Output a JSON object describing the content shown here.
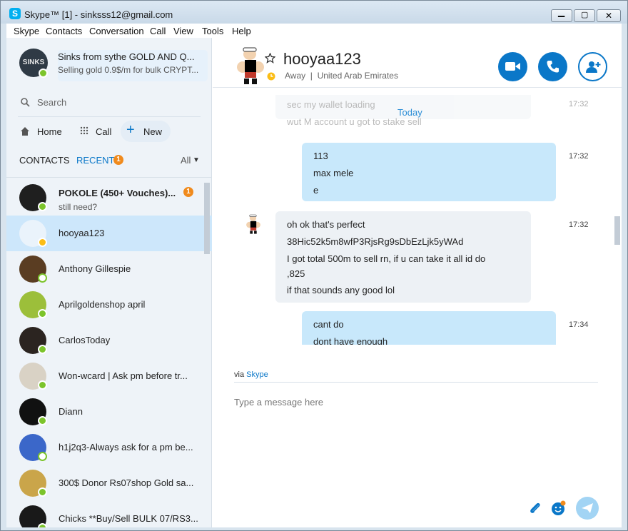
{
  "window": {
    "title": "Skype™ [1] - sinksss12@gmail.com",
    "minimize_label": "▁",
    "maximize_label": "▢",
    "close_label": "✕"
  },
  "menu": [
    "Skype",
    "Contacts",
    "Conversation",
    "Call",
    "View",
    "Tools",
    "Help"
  ],
  "profile": {
    "avatar_text": "SINKS",
    "name": "Sinks from sythe GOLD AND Q...",
    "mood": "Selling gold 0.9$/m for bulk CRYPT..."
  },
  "search": {
    "label": "Search"
  },
  "nav": {
    "home": "Home",
    "call": "Call",
    "new": "New"
  },
  "tabs": {
    "contacts": "CONTACTS",
    "recent": "RECENT",
    "recent_badge": "1",
    "filter": "All"
  },
  "contacts": [
    {
      "name": "POKOLE (450+ Vouches)...",
      "sub": "still need?",
      "status": "online",
      "badge": "1",
      "bold": true
    },
    {
      "name": "hooyaa123",
      "sub": "",
      "status": "away",
      "badge": "",
      "bold": false
    },
    {
      "name": "Anthony Gillespie",
      "sub": "",
      "status": "offline",
      "badge": "",
      "bold": false
    },
    {
      "name": "Aprilgoldenshop april",
      "sub": "",
      "status": "online",
      "badge": "",
      "bold": false
    },
    {
      "name": "CarlosToday",
      "sub": "",
      "status": "online",
      "badge": "",
      "bold": false
    },
    {
      "name": "Won-wcard | Ask pm before tr...",
      "sub": "",
      "status": "online",
      "badge": "",
      "bold": false
    },
    {
      "name": "Diann",
      "sub": "",
      "status": "online",
      "badge": "",
      "bold": false
    },
    {
      "name": "h1j2q3-Always ask for a pm be...",
      "sub": "",
      "status": "offline",
      "badge": "",
      "bold": false
    },
    {
      "name": "300$ Donor Rs07shop Gold sa...",
      "sub": "",
      "status": "online",
      "badge": "",
      "bold": false
    },
    {
      "name": "Chicks **Buy/Sell BULK 07/RS3...",
      "sub": "",
      "status": "online",
      "badge": "",
      "bold": false
    }
  ],
  "header": {
    "name": "hooyaa123",
    "status": "Away",
    "location": "United Arab Emirates"
  },
  "chat": {
    "today": "Today",
    "faded_lines": [
      "sec my wallet loading",
      "wut M account u got to stake sell"
    ],
    "faded_time": "17:32",
    "messages": [
      {
        "direction": "out",
        "time": "17:32",
        "lines": [
          "113",
          "max mele",
          "e"
        ]
      },
      {
        "direction": "in",
        "time": "17:32",
        "lines": [
          "oh ok that's perfect",
          "38Hic52k5m8wfP3RjsRg9sDbEzLjk5yWAd",
          "I got total 500m to sell rn, if u can take it all id do",
          ",825",
          "if that sounds any good lol"
        ]
      },
      {
        "direction": "out",
        "time": "17:34",
        "lines": [
          "cant do",
          "dont have enough"
        ]
      }
    ]
  },
  "compose": {
    "via": "via",
    "via_service": "Skype",
    "placeholder": "Type a message here"
  },
  "colors": {
    "accent": "#0a77c8",
    "online": "#7cc42b",
    "away": "#fbbd16",
    "badge": "#f08a1c"
  }
}
